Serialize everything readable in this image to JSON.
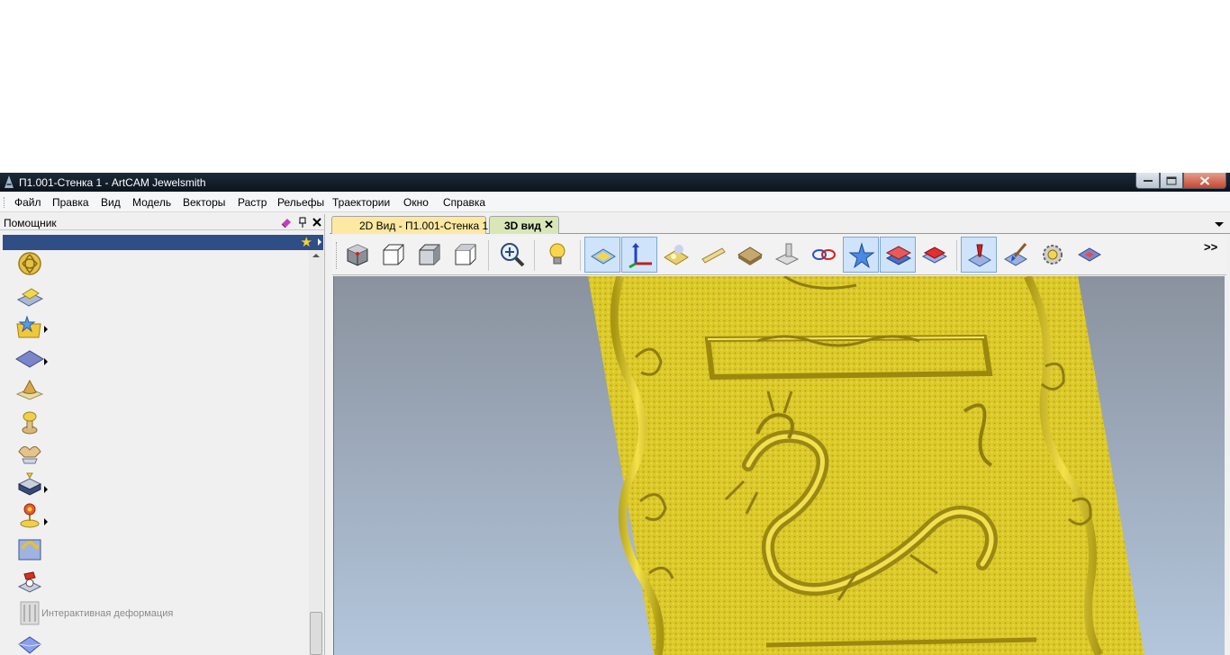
{
  "window": {
    "title": "П1.001-Стенка 1 - ArtCAM Jewelsmith"
  },
  "menu": [
    "Файл",
    "Правка",
    "Вид",
    "Модель",
    "Векторы",
    "Растр",
    "Рельефы",
    "Траектории",
    "Окно",
    "Справка"
  ],
  "panel": {
    "title": "Помощник",
    "tools": [
      {
        "icon": "celtic-knot-icon",
        "submenu": false
      },
      {
        "icon": "layer-sheet-icon",
        "submenu": false
      },
      {
        "icon": "star-folder-icon",
        "submenu": true
      },
      {
        "icon": "diamond-plane-icon",
        "submenu": true
      },
      {
        "icon": "cone-icon",
        "submenu": false
      },
      {
        "icon": "dome-icon",
        "submenu": false
      },
      {
        "icon": "hands-icon",
        "submenu": false
      },
      {
        "icon": "book-icon",
        "submenu": true
      },
      {
        "icon": "flower-disc-icon",
        "submenu": true
      },
      {
        "icon": "arch-arrow-icon",
        "submenu": false
      },
      {
        "icon": "figure-icon",
        "submenu": false
      },
      {
        "icon": "interactive-deform-icon",
        "submenu": false,
        "label": "Интерактивная деформация"
      },
      {
        "icon": "gem-icon",
        "submenu": false
      }
    ]
  },
  "tabs": [
    {
      "label": "2D Вид - П1.001-Стенка 1",
      "active": false
    },
    {
      "label": "3D вид",
      "active": true
    }
  ],
  "toolbar": {
    "buttons": [
      {
        "icon": "iso-view-icon",
        "active": false
      },
      {
        "icon": "front-view-icon",
        "active": false
      },
      {
        "icon": "right-view-icon",
        "active": false
      },
      {
        "icon": "top-view-icon",
        "active": false
      },
      {
        "icon": "zoom-icon",
        "active": false
      },
      {
        "icon": "light-bulb-icon",
        "active": false
      },
      {
        "icon": "plane-display-icon",
        "active": true
      },
      {
        "icon": "axes-icon",
        "active": true
      },
      {
        "icon": "relief-shade-icon",
        "active": false
      },
      {
        "icon": "bar-icon",
        "active": false
      },
      {
        "icon": "texture-block-icon",
        "active": false
      },
      {
        "icon": "machine-icon",
        "active": false
      },
      {
        "icon": "toolpath-icon",
        "active": false
      },
      {
        "icon": "star-vector-icon",
        "active": true
      },
      {
        "icon": "layers-icon",
        "active": true
      },
      {
        "icon": "red-layer-icon",
        "active": false
      },
      {
        "icon": "sim-toolpath-icon",
        "active": true
      },
      {
        "icon": "paint-brush-icon",
        "active": false
      },
      {
        "icon": "settings-gear-icon",
        "active": false
      },
      {
        "icon": "gem-diamond-icon",
        "active": false
      }
    ],
    "more": ">>"
  },
  "colors": {
    "relief": "#e0cc2a",
    "panel_bar": "#2f4e86",
    "tab_2d": "#fde9a2",
    "tab_3d": "#d9e6b8"
  }
}
